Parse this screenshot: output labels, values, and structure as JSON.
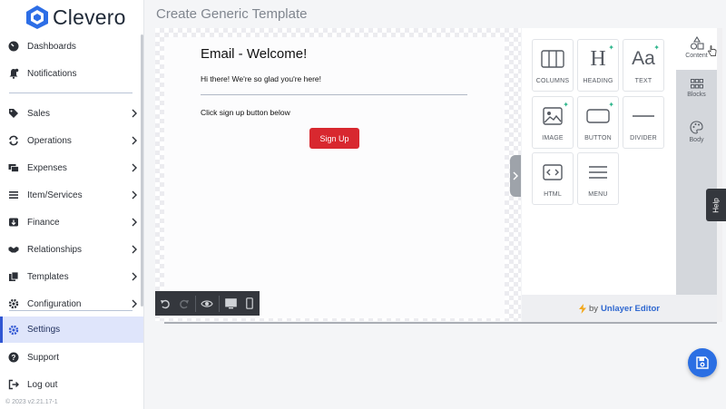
{
  "app": {
    "name": "Clevero"
  },
  "sidebar": {
    "items": [
      {
        "label": "Dashboards",
        "icon": "dashboard-gauge-icon",
        "has_chevron": false
      },
      {
        "label": "Notifications",
        "icon": "bell-icon",
        "has_chevron": false
      },
      {
        "label": "Sales",
        "icon": "tag-icon",
        "has_chevron": true
      },
      {
        "label": "Operations",
        "icon": "arrows-cycle-icon",
        "has_chevron": true
      },
      {
        "label": "Expenses",
        "icon": "money-icon",
        "has_chevron": true
      },
      {
        "label": "Item/Services",
        "icon": "list-icon",
        "has_chevron": true
      },
      {
        "label": "Finance",
        "icon": "bank-icon",
        "has_chevron": true
      },
      {
        "label": "Relationships",
        "icon": "handshake-icon",
        "has_chevron": true
      },
      {
        "label": "Templates",
        "icon": "copy-icon",
        "has_chevron": true
      },
      {
        "label": "Configuration",
        "icon": "gear-icon",
        "has_chevron": true
      },
      {
        "label": "Settings",
        "icon": "cog-icon",
        "has_chevron": false,
        "active": true
      },
      {
        "label": "Support",
        "icon": "question-circle-icon",
        "has_chevron": false
      },
      {
        "label": "Log out",
        "icon": "logout-icon",
        "has_chevron": false
      }
    ],
    "version_text": "© 2023   v2.21.17-1"
  },
  "header": {
    "title": "Create Generic Template"
  },
  "email": {
    "heading": "Email - Welcome!",
    "greeting": "Hi there! We're so glad you're here!",
    "instruction": "Click sign up button below",
    "button_label": "Sign Up"
  },
  "toolbar": {
    "icons": [
      "undo-icon",
      "redo-icon",
      "eye-preview-icon",
      "desktop-icon",
      "mobile-icon"
    ]
  },
  "tools": [
    {
      "label": "COLUMNS",
      "icon": "columns-icon",
      "sparkle": false
    },
    {
      "label": "HEADING",
      "icon": "heading-icon",
      "sparkle": true
    },
    {
      "label": "TEXT",
      "icon": "text-icon",
      "sparkle": true
    },
    {
      "label": "IMAGE",
      "icon": "image-icon",
      "sparkle": true
    },
    {
      "label": "BUTTON",
      "icon": "button-icon",
      "sparkle": true
    },
    {
      "label": "DIVIDER",
      "icon": "divider-icon",
      "sparkle": false
    },
    {
      "label": "HTML",
      "icon": "code-icon",
      "sparkle": false
    },
    {
      "label": "MENU",
      "icon": "menu-icon",
      "sparkle": false
    }
  ],
  "tools_glyphs": {
    "heading": "H",
    "text": "Aa",
    "sparkle": "✦"
  },
  "side_tabs": [
    {
      "label": "Content",
      "icon": "shapes-icon",
      "active": true
    },
    {
      "label": "Blocks",
      "icon": "grid-icon",
      "active": false
    },
    {
      "label": "Body",
      "icon": "palette-icon",
      "active": false
    }
  ],
  "help": {
    "label": "Help"
  },
  "footer": {
    "by": "by",
    "brand": "Unlayer Editor"
  },
  "colors": {
    "accent": "#3056d3",
    "signup": "#d8282f",
    "fab": "#2b6fe3",
    "brand_link": "#2f68d0"
  }
}
